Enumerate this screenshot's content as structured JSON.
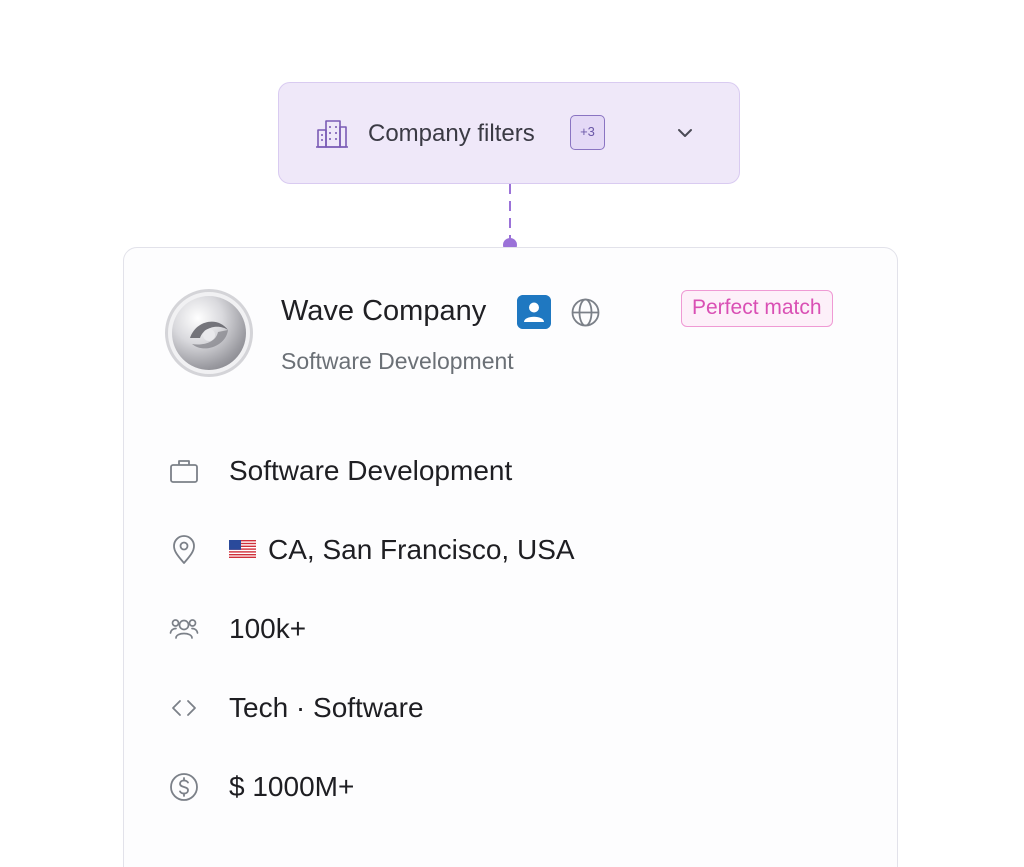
{
  "filter": {
    "label": "Company filters",
    "count": "+3",
    "icon": "building-icon",
    "expand_icon": "chevron-down-icon"
  },
  "card": {
    "name": "Wave Company",
    "subtitle": "Software Development",
    "badge": "Perfect match",
    "profile_icon": "profile-icon",
    "website_icon": "globe-icon",
    "details": {
      "industry": {
        "icon": "briefcase-icon",
        "text": "Software Development"
      },
      "location": {
        "icon": "location-pin-icon",
        "flag": "us-flag-icon",
        "text": "CA, San Francisco, USA"
      },
      "employees": {
        "icon": "people-icon",
        "text": "100k+"
      },
      "tech": {
        "icon": "code-icon",
        "text": "Tech · Software"
      },
      "revenue": {
        "icon": "dollar-circle-icon",
        "text": "$ 1000M+"
      }
    }
  },
  "colors": {
    "accent_purple": "#9b72d8",
    "badge_pink": "#d94fb4",
    "profile_blue": "#1f78c1"
  }
}
